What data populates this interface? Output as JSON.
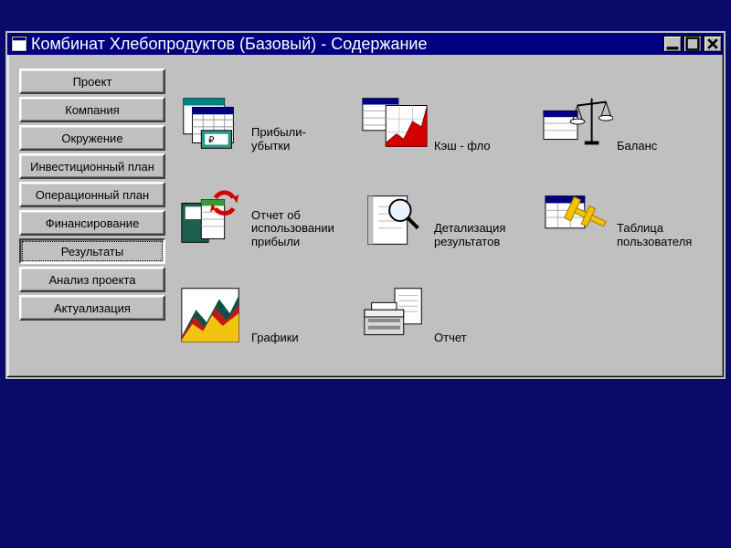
{
  "window": {
    "title": "Комбинат Хлебопродуктов (Базовый) - Содержание"
  },
  "sidebar": {
    "items": [
      {
        "label": "Проект"
      },
      {
        "label": "Компания"
      },
      {
        "label": "Окружение"
      },
      {
        "label": "Инвестиционный план"
      },
      {
        "label": "Операционный план"
      },
      {
        "label": "Финансирование"
      },
      {
        "label": "Результаты"
      },
      {
        "label": "Анализ проекта"
      },
      {
        "label": "Актуализация"
      }
    ],
    "active_index": 6
  },
  "tiles": [
    {
      "label": "Прибыли-\nубытки"
    },
    {
      "label": "Кэш - фло"
    },
    {
      "label": "Баланс"
    },
    {
      "label": "Отчет об\nиспользовании\nприбыли"
    },
    {
      "label": "Детализация\nрезультатов"
    },
    {
      "label": "Таблица\nпользователя"
    },
    {
      "label": "Графики"
    },
    {
      "label": "Отчет"
    }
  ]
}
